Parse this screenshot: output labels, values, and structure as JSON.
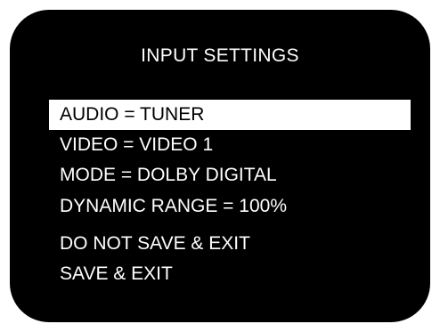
{
  "menu": {
    "title": "INPUT SETTINGS",
    "items": [
      {
        "label": "AUDIO = TUNER",
        "selected": true
      },
      {
        "label": "VIDEO = VIDEO 1",
        "selected": false
      },
      {
        "label": "MODE = DOLBY DIGITAL",
        "selected": false
      },
      {
        "label": "DYNAMIC RANGE = 100%",
        "selected": false
      },
      {
        "label": "DO NOT SAVE & EXIT",
        "selected": false
      },
      {
        "label": "SAVE & EXIT",
        "selected": false
      }
    ]
  },
  "colors": {
    "screen_background": "#000000",
    "text": "#ffffff",
    "highlight_background": "#ffffff",
    "highlight_text": "#000000"
  }
}
